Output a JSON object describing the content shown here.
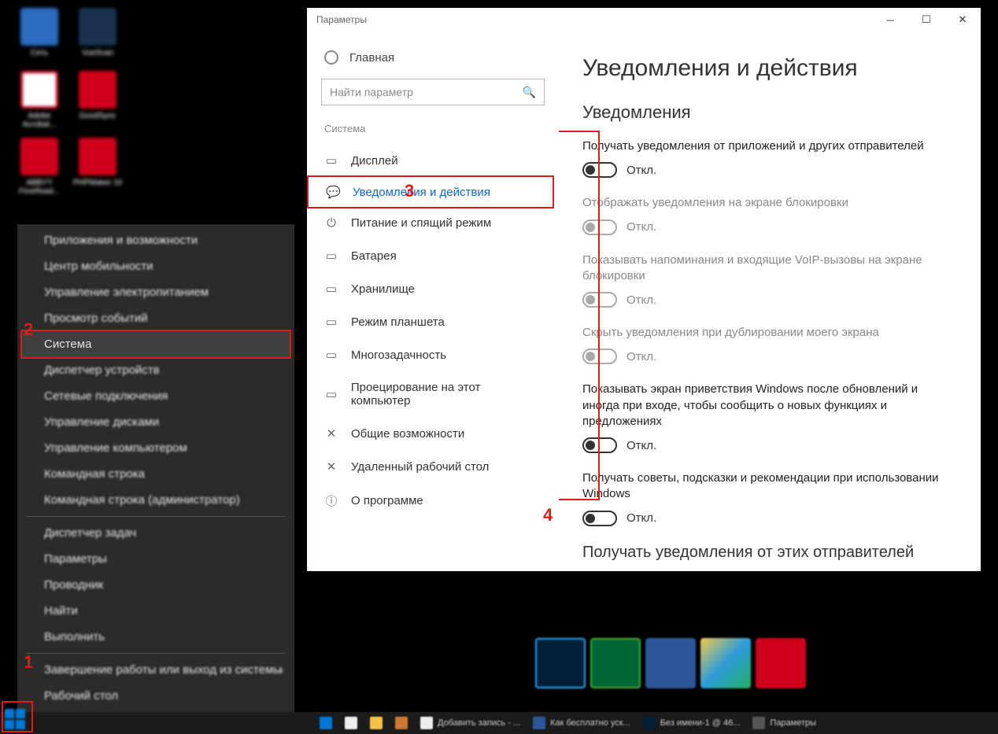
{
  "desktop_icons": [
    {
      "label": "Сеть",
      "color": "#2c6bbf"
    },
    {
      "label": "VueScan",
      "color": "#18324f"
    },
    {
      "label": "Adobe Acrobat...",
      "color": "#d0021b"
    },
    {
      "label": "GoodSync",
      "color": "#d0021b"
    },
    {
      "label": "ABBYY FineRead...",
      "color": "#d0021b"
    },
    {
      "label": "PHPMaker 10",
      "color": "#d0021b"
    }
  ],
  "winx": {
    "items": [
      "Приложения и возможности",
      "Центр мобильности",
      "Управление электропитанием",
      "Просмотр событий",
      "Система",
      "Диспетчер устройств",
      "Сетевые подключения",
      "Управление дисками",
      "Управление компьютером",
      "Командная строка",
      "Командная строка (администратор)"
    ],
    "items2": [
      "Диспетчер задач",
      "Параметры",
      "Проводник",
      "Найти",
      "Выполнить"
    ],
    "items3": [
      "Завершение работы или выход из системы",
      "Рабочий стол"
    ],
    "highlight_index": 4
  },
  "settings": {
    "window_title": "Параметры",
    "home": "Главная",
    "search_placeholder": "Найти параметр",
    "group": "Система",
    "side_items": [
      {
        "icon": "▭",
        "label": "Дисплей"
      },
      {
        "icon": "💬",
        "label": "Уведомления и действия",
        "selected": true
      },
      {
        "icon": "⏻",
        "label": "Питание и спящий режим"
      },
      {
        "icon": "▭",
        "label": "Батарея"
      },
      {
        "icon": "▭",
        "label": "Хранилище"
      },
      {
        "icon": "▭",
        "label": "Режим планшета"
      },
      {
        "icon": "▭",
        "label": "Многозадачность"
      },
      {
        "icon": "▭",
        "label": "Проецирование на этот компьютер"
      },
      {
        "icon": "✕",
        "label": "Общие возможности"
      },
      {
        "icon": "✕",
        "label": "Удаленный рабочий стол"
      },
      {
        "icon": "ⓘ",
        "label": "О программе"
      }
    ],
    "page_title": "Уведомления и действия",
    "section_notifications": "Уведомления",
    "toggles": [
      {
        "label": "Получать уведомления от приложений и других отправителей",
        "state": "Откл.",
        "disabled": false
      },
      {
        "label": "Отображать уведомления на экране блокировки",
        "state": "Откл.",
        "disabled": true
      },
      {
        "label": "Показывать напоминания и входящие VoIP-вызовы на экране блокировки",
        "state": "Откл.",
        "disabled": true
      },
      {
        "label": "Скрыть уведомления при дублировании моего экрана",
        "state": "Откл.",
        "disabled": true
      },
      {
        "label": "Показывать экран приветствия Windows после обновлений и иногда при входе, чтобы сообщить о новых функциях и предложениях",
        "state": "Откл.",
        "disabled": false
      },
      {
        "label": "Получать советы, подсказки и рекомендации при использовании Windows",
        "state": "Откл.",
        "disabled": false
      }
    ],
    "section_senders": "Получать уведомления от этих отправителей"
  },
  "annotations": {
    "n1": "1",
    "n2": "2",
    "n3": "3",
    "n4": "4"
  },
  "taskbar": {
    "items": [
      {
        "color": "#0078d7",
        "label": ""
      },
      {
        "color": "#eee",
        "label": ""
      },
      {
        "color": "#f6c344",
        "label": ""
      },
      {
        "color": "#cc7832",
        "label": ""
      },
      {
        "color": "#eee",
        "label": "Добавить запись - ..."
      },
      {
        "color": "#2b579a",
        "label": "Как бесплатно уск..."
      },
      {
        "color": "#001e36",
        "label": "Без имени-1 @ 46..."
      },
      {
        "color": "#555",
        "label": "Параметры"
      }
    ]
  },
  "big_dock": [
    {
      "color": "#001e36"
    },
    {
      "color": "#4fae33"
    },
    {
      "color": "#2b579a"
    },
    {
      "color": "linear"
    },
    {
      "color": "#d0021b"
    }
  ]
}
